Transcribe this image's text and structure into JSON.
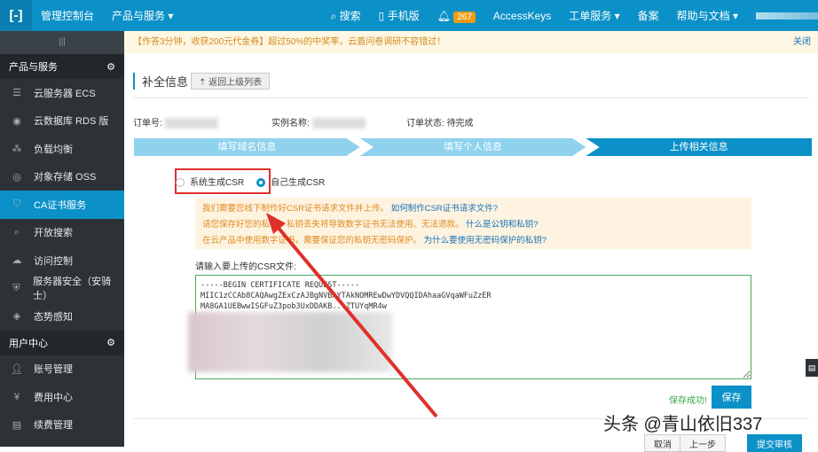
{
  "topbar": {
    "console": "管理控制台",
    "products": "产品与服务 ▾",
    "search": "搜索",
    "mobile": "手机版",
    "notifications": "267",
    "accesskeys": "AccessKeys",
    "tickets": "工单服务 ▾",
    "beian": "备案",
    "help": "帮助与文档 ▾"
  },
  "sidebar": {
    "handle": "|||",
    "group1": "产品与服务",
    "items1": [
      "云服务器 ECS",
      "云数据库 RDS 版",
      "负载均衡",
      "对象存储 OSS",
      "CA证书服务",
      "开放搜索",
      "访问控制",
      "服务器安全（安骑士）",
      "态势感知"
    ],
    "group2": "用户中心",
    "items2": [
      "账号管理",
      "费用中心",
      "续费管理"
    ]
  },
  "notice": {
    "text": "【作答3分钟，收获200元代金券】超过50%的中奖率，云盾问卷调研不容错过！",
    "close": "关闭"
  },
  "main": {
    "title": "补全信息",
    "back": "返回上级列表",
    "order_no_label": "订单号:",
    "instance_label": "实例名称:",
    "status_label": "订单状态:",
    "status": "待完成",
    "steps": [
      "填写域名信息",
      "填写个人信息",
      "上传相关信息"
    ],
    "radio_system": "系统生成CSR",
    "radio_self": "自己生成CSR",
    "tips": [
      {
        "text": "我们需要您线下制作好CSR证书请求文件并上传。",
        "link": "如何制作CSR证书请求文件?"
      },
      {
        "text": "请您保存好您的私钥，私钥丢失将导致数字证书无法使用、无法退款。",
        "link": "什么是公钥和私钥?"
      },
      {
        "text": "在云产品中使用数字证书，需要保证您的私钥无密码保护。",
        "link": "为什么要使用无密码保护的私钥?"
      }
    ],
    "csr_label": "请输入要上传的CSR文件:",
    "csr_value": "-----BEGIN CERTIFICATE REQUEST-----\nMIIC1zCCAb8CAQAwgZExCzAJBgNVBAYTAkNOMREwDwYDVQQIDAhaaGVqaWFuZzER\nMA8GA1UEBwwISGFuZ3pob3UxDDAKB...ZTUYqMR4w\n\n\n\n\n...UzZDGAxbHzLas1Gah",
    "save_ok": "保存成功!",
    "save": "保存",
    "cancel": "取消",
    "prev": "上一步",
    "submit": "提交审核"
  },
  "watermark": "头条 @青山依旧337"
}
